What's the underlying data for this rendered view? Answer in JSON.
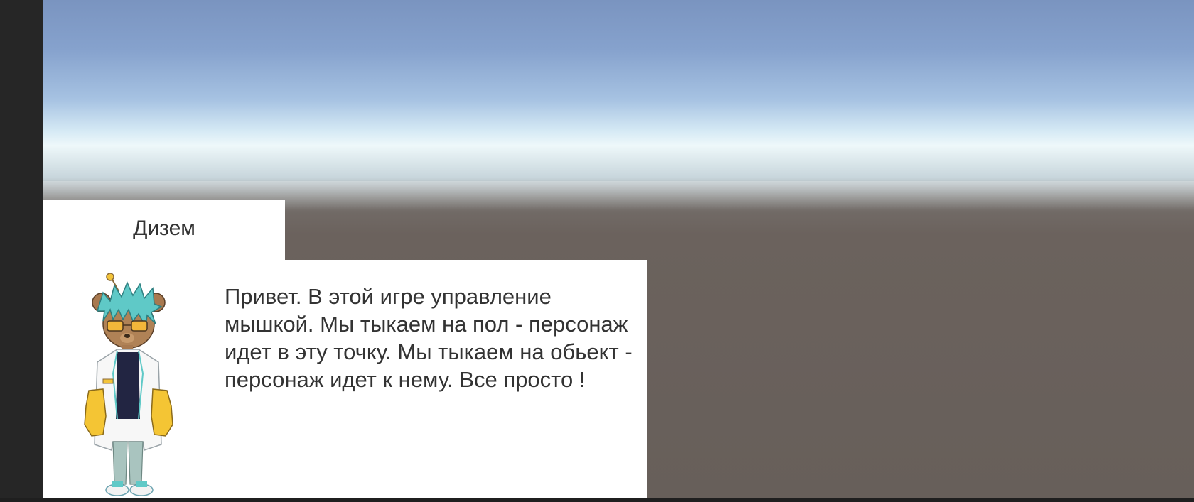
{
  "dialog": {
    "speaker_name": "Дизем",
    "message": "Привет. В этой игре управление мышкой. Мы тыкаем на пол - персонаж идет в эту точку. Мы тыкаем на обьект - персонаж идет к нему. Все просто !",
    "portrait": "bear-scientist-character-portrait"
  },
  "colors": {
    "sky_top": "#7a94c0",
    "horizon": "#eef8fa",
    "ground": "#675f5a",
    "panel": "#ffffff",
    "text": "#333333"
  }
}
